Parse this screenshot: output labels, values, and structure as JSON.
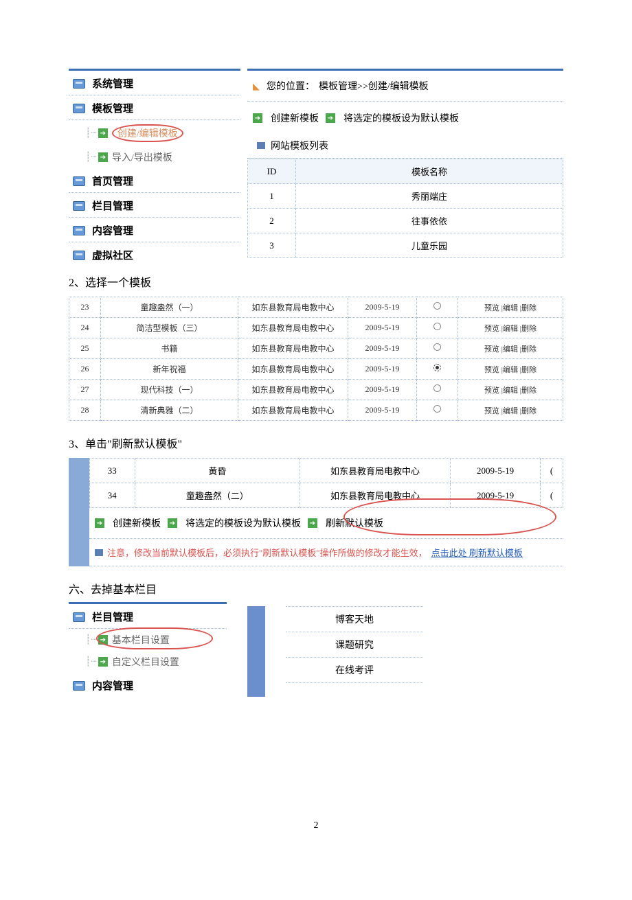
{
  "sidebar1": {
    "items": [
      "系统管理",
      "模板管理",
      "首页管理",
      "栏目管理",
      "内容管理",
      "虚拟社区"
    ],
    "sub1": "创建/编辑模板",
    "sub2": "导入/导出模板"
  },
  "breadcrumb": {
    "label": "您的位置：",
    "path": "模板管理>>创建/编辑模板"
  },
  "toolbar1": {
    "btn1": "创建新模板",
    "btn2": "将选定的模板设为默认模板"
  },
  "listHeader": "网站模板列表",
  "miniTable": {
    "headers": [
      "ID",
      "模板名称"
    ],
    "rows": [
      [
        "1",
        "秀丽端庄"
      ],
      [
        "2",
        "往事依依"
      ],
      [
        "3",
        "儿童乐园"
      ]
    ]
  },
  "step2": "2、选择一个模板",
  "table2": {
    "rows": [
      {
        "id": "23",
        "name": "童趣盎然（一）",
        "publisher": "如东县教育局电教中心",
        "date": "2009-5-19",
        "selected": false
      },
      {
        "id": "24",
        "name": "简洁型模板（三）",
        "publisher": "如东县教育局电教中心",
        "date": "2009-5-19",
        "selected": false
      },
      {
        "id": "25",
        "name": "书籍",
        "publisher": "如东县教育局电教中心",
        "date": "2009-5-19",
        "selected": false
      },
      {
        "id": "26",
        "name": "新年祝福",
        "publisher": "如东县教育局电教中心",
        "date": "2009-5-19",
        "selected": true
      },
      {
        "id": "27",
        "name": "现代科技（一）",
        "publisher": "如东县教育局电教中心",
        "date": "2009-5-19",
        "selected": false
      },
      {
        "id": "28",
        "name": "清新典雅（二）",
        "publisher": "如东县教育局电教中心",
        "date": "2009-5-19",
        "selected": false
      }
    ],
    "actions": "预览 |编辑 |删除"
  },
  "step3": "3、单击\"刷新默认模板\"",
  "table3": {
    "rows": [
      {
        "id": "33",
        "name": "黄昏",
        "publisher": "如东县教育局电教中心",
        "date": "2009-5-19"
      },
      {
        "id": "34",
        "name": "童趣盎然（二）",
        "publisher": "如东县教育局电教中心",
        "date": "2009-5-19"
      }
    ]
  },
  "toolbar3": {
    "btn1": "创建新模板",
    "btn2": "将选定的模板设为默认模板",
    "btn3": "刷新默认模板"
  },
  "note": {
    "text": "注意，修改当前默认模板后，必须执行\"刷新默认模板\"操作所做的修改才能生效，",
    "link": "点击此处 刷新默认模板"
  },
  "section6Title": "六、去掉基本栏目",
  "sidebar6": {
    "item1": "栏目管理",
    "sub1": "基本栏目设置",
    "sub2": "自定义栏目设置",
    "item2": "内容管理"
  },
  "list6": [
    "博客天地",
    "课题研究",
    "在线考评"
  ],
  "pageNum": "2"
}
